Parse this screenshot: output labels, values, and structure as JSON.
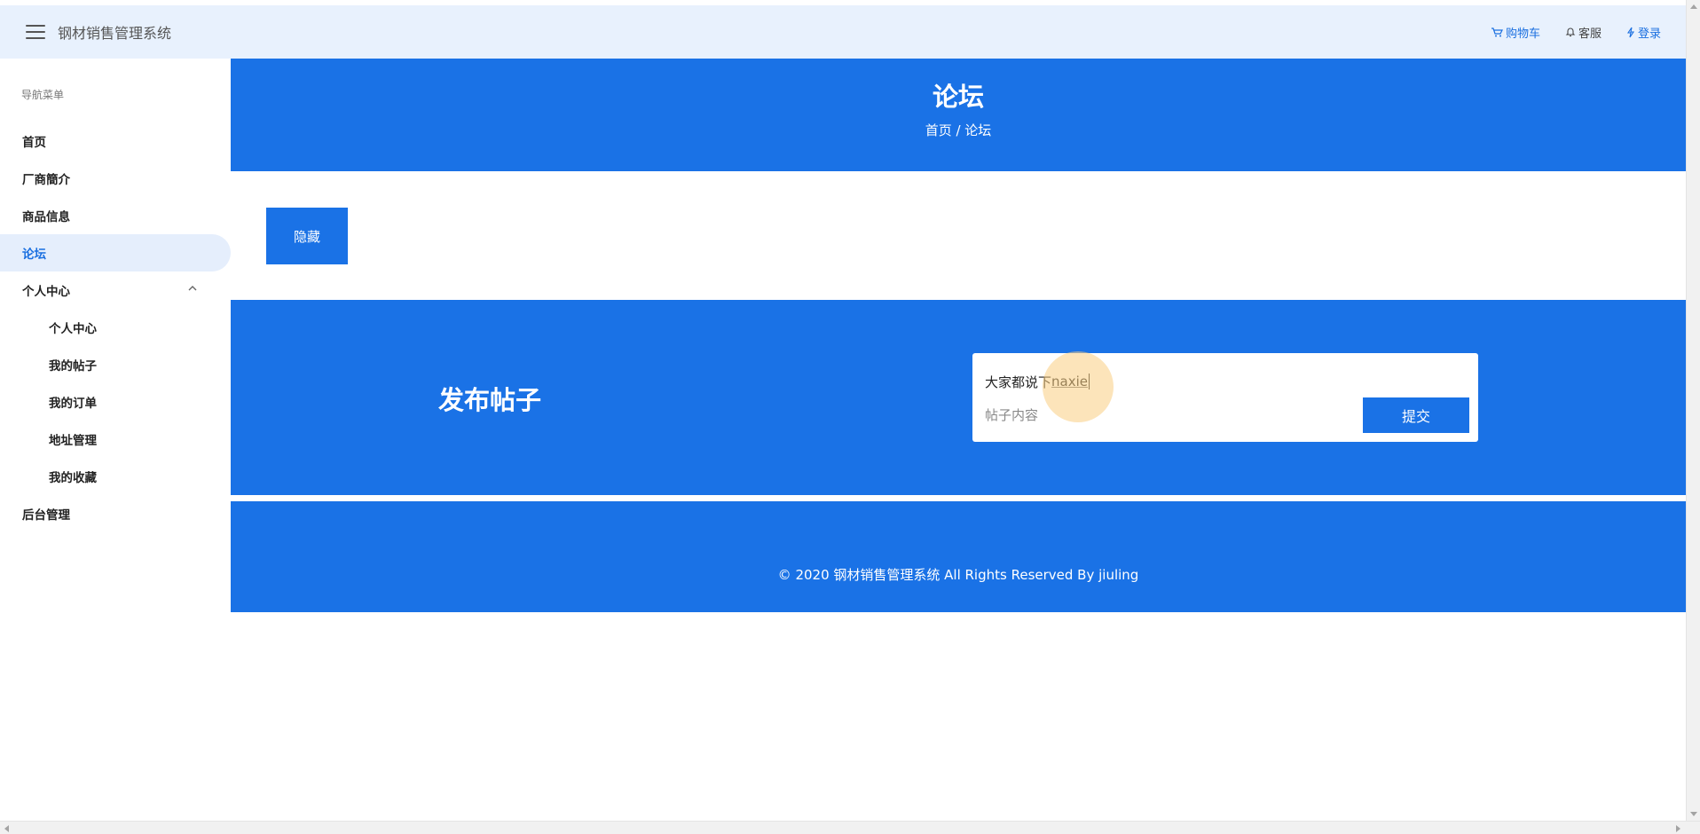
{
  "header": {
    "brand": "钢材销售管理系统",
    "cart_label": "购物车",
    "service_label": "客服",
    "login_label": "登录"
  },
  "sidebar": {
    "nav_title": "导航菜单",
    "items": [
      {
        "label": "首页"
      },
      {
        "label": "厂商簡介"
      },
      {
        "label": "商品信息"
      },
      {
        "label": "论坛"
      },
      {
        "label": "个人中心"
      },
      {
        "label": "个人中心"
      },
      {
        "label": "我的帖子"
      },
      {
        "label": "我的订单"
      },
      {
        "label": "地址管理"
      },
      {
        "label": "我的收藏"
      },
      {
        "label": "后台管理"
      }
    ]
  },
  "hero": {
    "title": "论坛",
    "breadcrumb": "首页 / 论坛"
  },
  "hide_button_label": "隐藏",
  "post": {
    "heading": "发布帖子",
    "title_value_plain": "大家都说下",
    "title_value_composing": "naxie",
    "content_placeholder": "帖子内容",
    "submit_label": "提交"
  },
  "footer": {
    "copyright": "© 2020 钢材销售管理系统 All Rights Reserved By jiuling"
  },
  "colors": {
    "primary": "#1a72e6",
    "header_bg": "#e8f1fd",
    "active_bg": "#e5eefc"
  }
}
